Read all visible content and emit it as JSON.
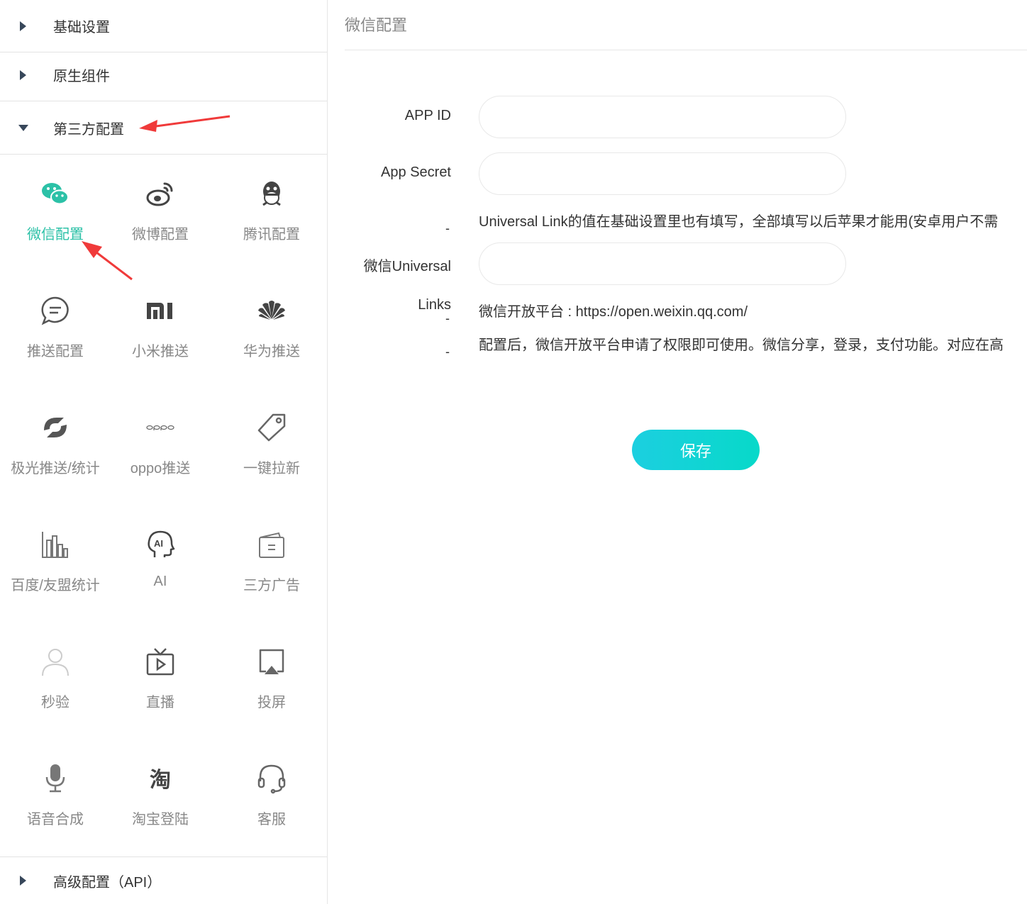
{
  "sidebar": {
    "sections": [
      {
        "label": "基础设置"
      },
      {
        "label": "原生组件"
      },
      {
        "label": "第三方配置"
      },
      {
        "label": "高级配置（API）"
      }
    ],
    "items": [
      {
        "label": "微信配置",
        "icon": "wechat-icon"
      },
      {
        "label": "微博配置",
        "icon": "weibo-icon"
      },
      {
        "label": "腾讯配置",
        "icon": "qq-icon"
      },
      {
        "label": "推送配置",
        "icon": "message-icon"
      },
      {
        "label": "小米推送",
        "icon": "xiaomi-icon"
      },
      {
        "label": "华为推送",
        "icon": "huawei-icon"
      },
      {
        "label": "极光推送/统计",
        "icon": "jiguang-icon"
      },
      {
        "label": "oppo推送",
        "icon": "oppo-icon"
      },
      {
        "label": "一键拉新",
        "icon": "tag-icon"
      },
      {
        "label": "百度/友盟统计",
        "icon": "bar-chart-icon"
      },
      {
        "label": "AI",
        "icon": "ai-head-icon"
      },
      {
        "label": "三方广告",
        "icon": "ad-card-icon"
      },
      {
        "label": "秒验",
        "icon": "user-icon"
      },
      {
        "label": "直播",
        "icon": "tv-play-icon"
      },
      {
        "label": "投屏",
        "icon": "screen-cast-icon"
      },
      {
        "label": "语音合成",
        "icon": "microphone-icon"
      },
      {
        "label": "淘宝登陆",
        "icon": "taobao-icon"
      },
      {
        "label": "客服",
        "icon": "headset-icon"
      }
    ]
  },
  "main": {
    "title": "微信配置",
    "form": {
      "app_id_label": "APP ID",
      "app_id_value": "",
      "app_secret_label": "App Secret",
      "app_secret_value": "",
      "universal_note": "Universal Link的值在基础设置里也有填写，全部填写以后苹果才能用(安卓用户不需",
      "universal_label_1": "微信Universal",
      "universal_label_2": "Links",
      "universal_value": "",
      "dash": "-",
      "open_platform": "微信开放平台 : https://open.weixin.qq.com/",
      "note": "配置后，微信开放平台申请了权限即可使用。微信分享，登录，支付功能。对应在高"
    },
    "save_label": "保存"
  },
  "colors": {
    "accent": "#2cc1a7",
    "save_button": "#07d9c9",
    "annotation_arrow": "#f03a3a"
  }
}
